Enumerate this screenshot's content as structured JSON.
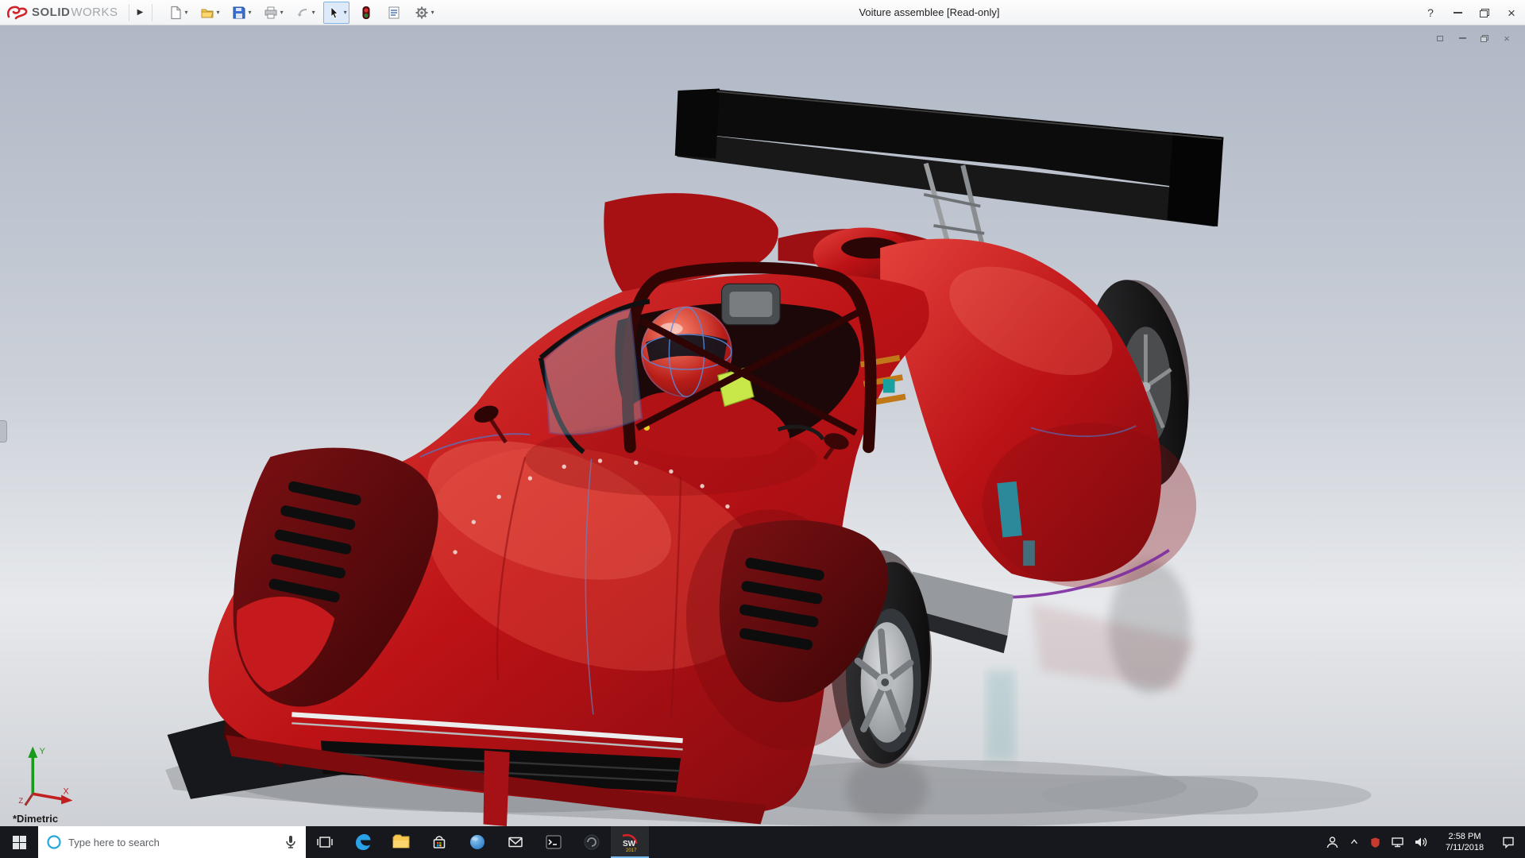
{
  "window": {
    "title": "Voiture assemblee [Read-only]",
    "help_glyph": "?",
    "close_glyph": "×"
  },
  "brand": {
    "solid": "SOLID",
    "works": "WORKS"
  },
  "toolbar": {
    "flyout_glyph": "▶",
    "caret_glyph": "▾",
    "icons": [
      "new-document",
      "open",
      "save",
      "print",
      "undo",
      "select",
      "rebuild",
      "file-properties",
      "options"
    ]
  },
  "child_window": {
    "close_glyph": "×"
  },
  "viewport": {
    "view_label": "*Dimetric",
    "triad": {
      "x": "X",
      "y": "Y",
      "z": "Z"
    },
    "model": "red Le Mans prototype race car with black rear wing, driver with helmet"
  },
  "taskbar": {
    "search_placeholder": "Type here to search",
    "time": "2:58 PM",
    "date": "7/11/2018",
    "apps": [
      "start",
      "search",
      "task-view",
      "edge",
      "file-explorer",
      "store",
      "browser-sphere",
      "mail",
      "command-prompt",
      "circular-app",
      "solidworks-2017"
    ],
    "tray": [
      "people",
      "hidden-icons-chevron",
      "shield",
      "network",
      "volume",
      "clock",
      "action-center"
    ]
  },
  "colors": {
    "brand_red": "#d2232a",
    "body_red": "#c11418",
    "taskbar_bg": "#16181d",
    "viewport_top": "#b2b9c6",
    "active_underline": "#76b9ed"
  }
}
